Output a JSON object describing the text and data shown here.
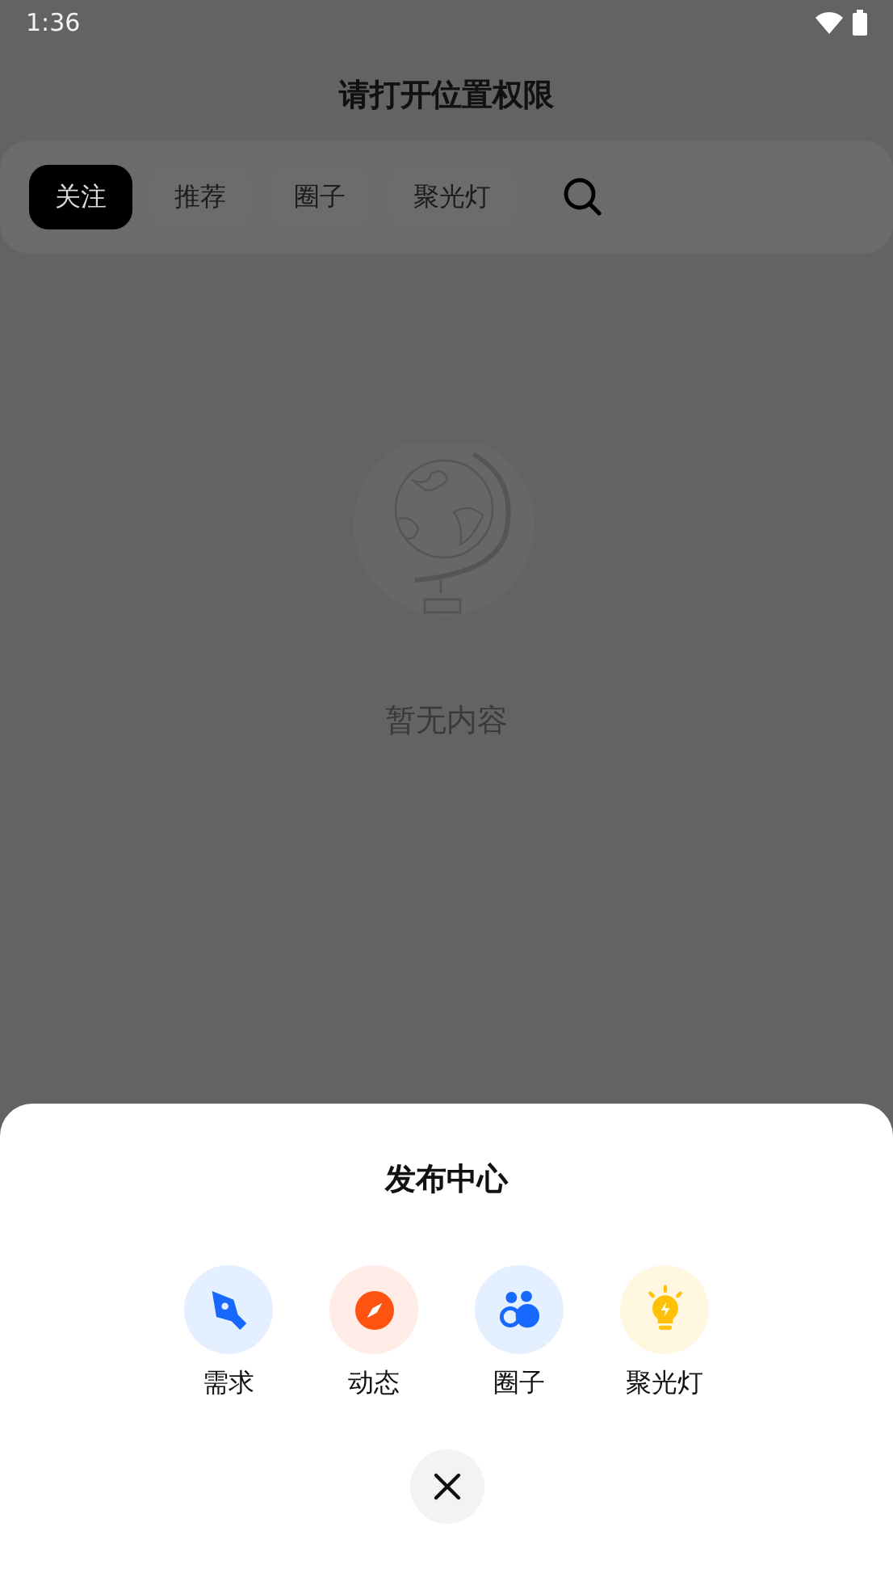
{
  "status_bar": {
    "time": "1:36"
  },
  "header": {
    "title": "请打开位置权限"
  },
  "tabs": [
    {
      "label": "关注",
      "selected": true
    },
    {
      "label": "推荐",
      "selected": false
    },
    {
      "label": "圈子",
      "selected": false
    },
    {
      "label": "聚光灯",
      "selected": false
    }
  ],
  "empty_state": {
    "message": "暂无内容"
  },
  "publish_sheet": {
    "title": "发布中心",
    "actions": [
      {
        "kind": "pen",
        "label": "需求"
      },
      {
        "kind": "compass",
        "label": "动态"
      },
      {
        "kind": "people",
        "label": "圈子"
      },
      {
        "kind": "bulb",
        "label": "聚光灯"
      }
    ]
  }
}
